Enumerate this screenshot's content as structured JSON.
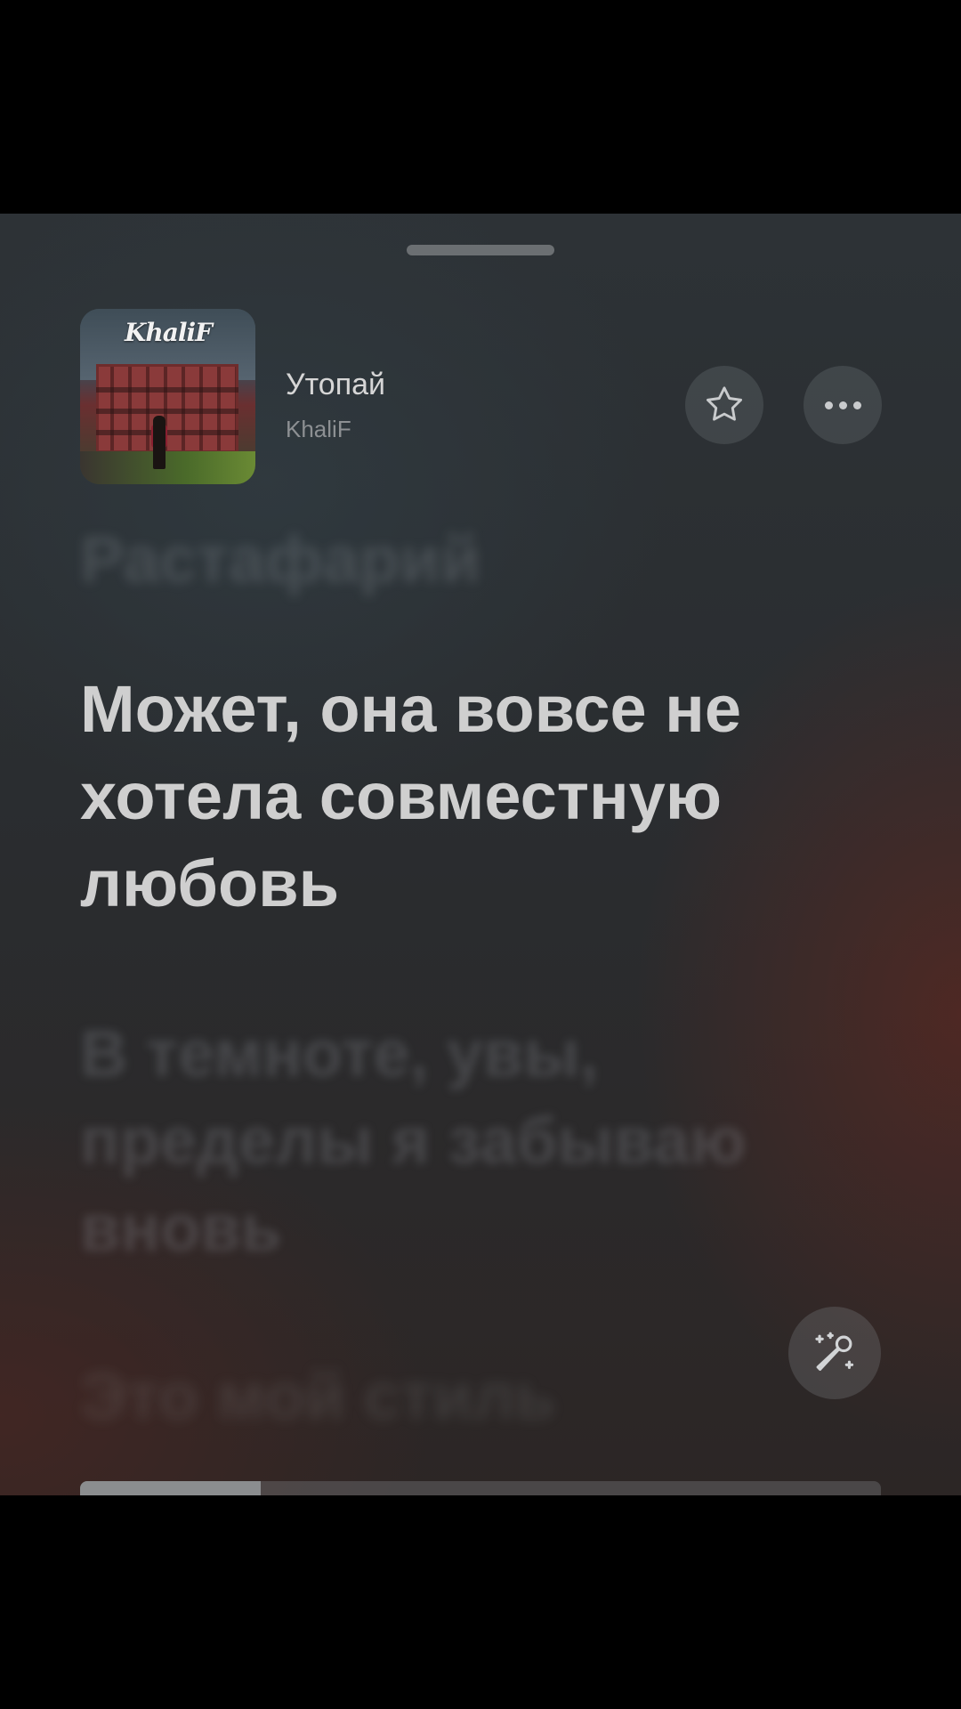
{
  "track": {
    "title": "Утопай",
    "artist": "KhaliF",
    "cover_logo_text": "KhaliF"
  },
  "lyrics": {
    "previous": "Растафарий",
    "current": "Может, она вовсе не хотела совместную любовь",
    "next": "В темноте, увы, пределы я забываю вновь",
    "next2": "Это мой стиль"
  },
  "playback": {
    "progress_fraction": 0.226
  },
  "icons": {
    "favorite": "star-outline-icon",
    "more": "ellipsis-icon",
    "sing": "microphone-sparkle-icon"
  },
  "colors": {
    "text_primary": "#cfcfcf",
    "text_secondary": "#8d9093",
    "accent_warm": "#542822"
  }
}
